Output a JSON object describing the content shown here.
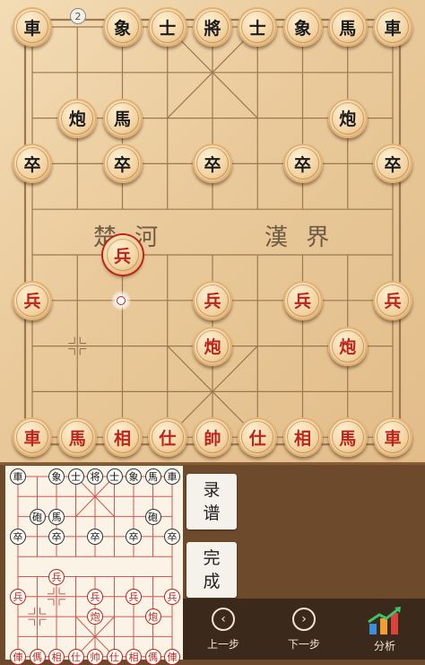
{
  "move_badge": "2",
  "river": {
    "left": "楚 河",
    "right": "漢 界"
  },
  "pieces": [
    {
      "c": 0,
      "r": 0,
      "ch": "車",
      "side": "black"
    },
    {
      "c": 2,
      "r": 0,
      "ch": "象",
      "side": "black"
    },
    {
      "c": 3,
      "r": 0,
      "ch": "士",
      "side": "black"
    },
    {
      "c": 4,
      "r": 0,
      "ch": "將",
      "side": "black"
    },
    {
      "c": 5,
      "r": 0,
      "ch": "士",
      "side": "black"
    },
    {
      "c": 6,
      "r": 0,
      "ch": "象",
      "side": "black"
    },
    {
      "c": 7,
      "r": 0,
      "ch": "馬",
      "side": "black"
    },
    {
      "c": 8,
      "r": 0,
      "ch": "車",
      "side": "black"
    },
    {
      "c": 1,
      "r": 2,
      "ch": "炮",
      "side": "black"
    },
    {
      "c": 2,
      "r": 2,
      "ch": "馬",
      "side": "black"
    },
    {
      "c": 7,
      "r": 2,
      "ch": "炮",
      "side": "black"
    },
    {
      "c": 0,
      "r": 3,
      "ch": "卒",
      "side": "black"
    },
    {
      "c": 2,
      "r": 3,
      "ch": "卒",
      "side": "black"
    },
    {
      "c": 4,
      "r": 3,
      "ch": "卒",
      "side": "black"
    },
    {
      "c": 6,
      "r": 3,
      "ch": "卒",
      "side": "black"
    },
    {
      "c": 8,
      "r": 3,
      "ch": "卒",
      "side": "black"
    },
    {
      "c": 2,
      "r": 5,
      "ch": "兵",
      "side": "red",
      "selected": true
    },
    {
      "c": 0,
      "r": 6,
      "ch": "兵",
      "side": "red"
    },
    {
      "c": 4,
      "r": 6,
      "ch": "兵",
      "side": "red"
    },
    {
      "c": 6,
      "r": 6,
      "ch": "兵",
      "side": "red"
    },
    {
      "c": 8,
      "r": 6,
      "ch": "兵",
      "side": "red"
    },
    {
      "c": 4,
      "r": 7,
      "ch": "炮",
      "side": "red"
    },
    {
      "c": 7,
      "r": 7,
      "ch": "炮",
      "side": "red"
    },
    {
      "c": 0,
      "r": 9,
      "ch": "車",
      "side": "red"
    },
    {
      "c": 1,
      "r": 9,
      "ch": "馬",
      "side": "red"
    },
    {
      "c": 2,
      "r": 9,
      "ch": "相",
      "side": "red"
    },
    {
      "c": 3,
      "r": 9,
      "ch": "仕",
      "side": "red"
    },
    {
      "c": 4,
      "r": 9,
      "ch": "帥",
      "side": "red"
    },
    {
      "c": 5,
      "r": 9,
      "ch": "仕",
      "side": "red"
    },
    {
      "c": 6,
      "r": 9,
      "ch": "相",
      "side": "red"
    },
    {
      "c": 7,
      "r": 9,
      "ch": "馬",
      "side": "red"
    },
    {
      "c": 8,
      "r": 9,
      "ch": "車",
      "side": "red"
    }
  ],
  "mini_pieces": [
    {
      "c": 0,
      "r": 0,
      "ch": "車",
      "side": "black"
    },
    {
      "c": 2,
      "r": 0,
      "ch": "象",
      "side": "black"
    },
    {
      "c": 3,
      "r": 0,
      "ch": "士",
      "side": "black"
    },
    {
      "c": 4,
      "r": 0,
      "ch": "将",
      "side": "black"
    },
    {
      "c": 5,
      "r": 0,
      "ch": "士",
      "side": "black"
    },
    {
      "c": 6,
      "r": 0,
      "ch": "象",
      "side": "black"
    },
    {
      "c": 7,
      "r": 0,
      "ch": "馬",
      "side": "black"
    },
    {
      "c": 8,
      "r": 0,
      "ch": "車",
      "side": "black"
    },
    {
      "c": 1,
      "r": 2,
      "ch": "砲",
      "side": "black"
    },
    {
      "c": 2,
      "r": 2,
      "ch": "馬",
      "side": "black"
    },
    {
      "c": 7,
      "r": 2,
      "ch": "砲",
      "side": "black"
    },
    {
      "c": 0,
      "r": 3,
      "ch": "卒",
      "side": "black"
    },
    {
      "c": 2,
      "r": 3,
      "ch": "卒",
      "side": "black"
    },
    {
      "c": 4,
      "r": 3,
      "ch": "卒",
      "side": "black"
    },
    {
      "c": 6,
      "r": 3,
      "ch": "卒",
      "side": "black"
    },
    {
      "c": 8,
      "r": 3,
      "ch": "卒",
      "side": "black"
    },
    {
      "c": 2,
      "r": 5,
      "ch": "兵",
      "side": "red"
    },
    {
      "c": 0,
      "r": 6,
      "ch": "兵",
      "side": "red"
    },
    {
      "c": 4,
      "r": 6,
      "ch": "兵",
      "side": "red"
    },
    {
      "c": 6,
      "r": 6,
      "ch": "兵",
      "side": "red"
    },
    {
      "c": 8,
      "r": 6,
      "ch": "兵",
      "side": "red"
    },
    {
      "c": 4,
      "r": 7,
      "ch": "炮",
      "side": "red"
    },
    {
      "c": 7,
      "r": 7,
      "ch": "炮",
      "side": "red"
    },
    {
      "c": 0,
      "r": 9,
      "ch": "俥",
      "side": "red"
    },
    {
      "c": 1,
      "r": 9,
      "ch": "傌",
      "side": "red"
    },
    {
      "c": 2,
      "r": 9,
      "ch": "相",
      "side": "red"
    },
    {
      "c": 3,
      "r": 9,
      "ch": "仕",
      "side": "red"
    },
    {
      "c": 4,
      "r": 9,
      "ch": "帅",
      "side": "red"
    },
    {
      "c": 5,
      "r": 9,
      "ch": "仕",
      "side": "red"
    },
    {
      "c": 6,
      "r": 9,
      "ch": "相",
      "side": "red"
    },
    {
      "c": 7,
      "r": 9,
      "ch": "傌",
      "side": "red"
    },
    {
      "c": 8,
      "r": 9,
      "ch": "俥",
      "side": "red"
    }
  ],
  "buttons": {
    "record": [
      "录",
      "谱"
    ],
    "finish": [
      "完",
      "成"
    ]
  },
  "nav": {
    "prev_label": "上一步",
    "prev_icon": "‹",
    "next_label": "下一步",
    "next_icon": "›",
    "analyze_label": "分析"
  },
  "colors": {
    "red_piece": "#c0231a",
    "black_piece": "#1b1b1b",
    "board": "#e9c99a",
    "bottom_bar": "#3b2a1c"
  }
}
